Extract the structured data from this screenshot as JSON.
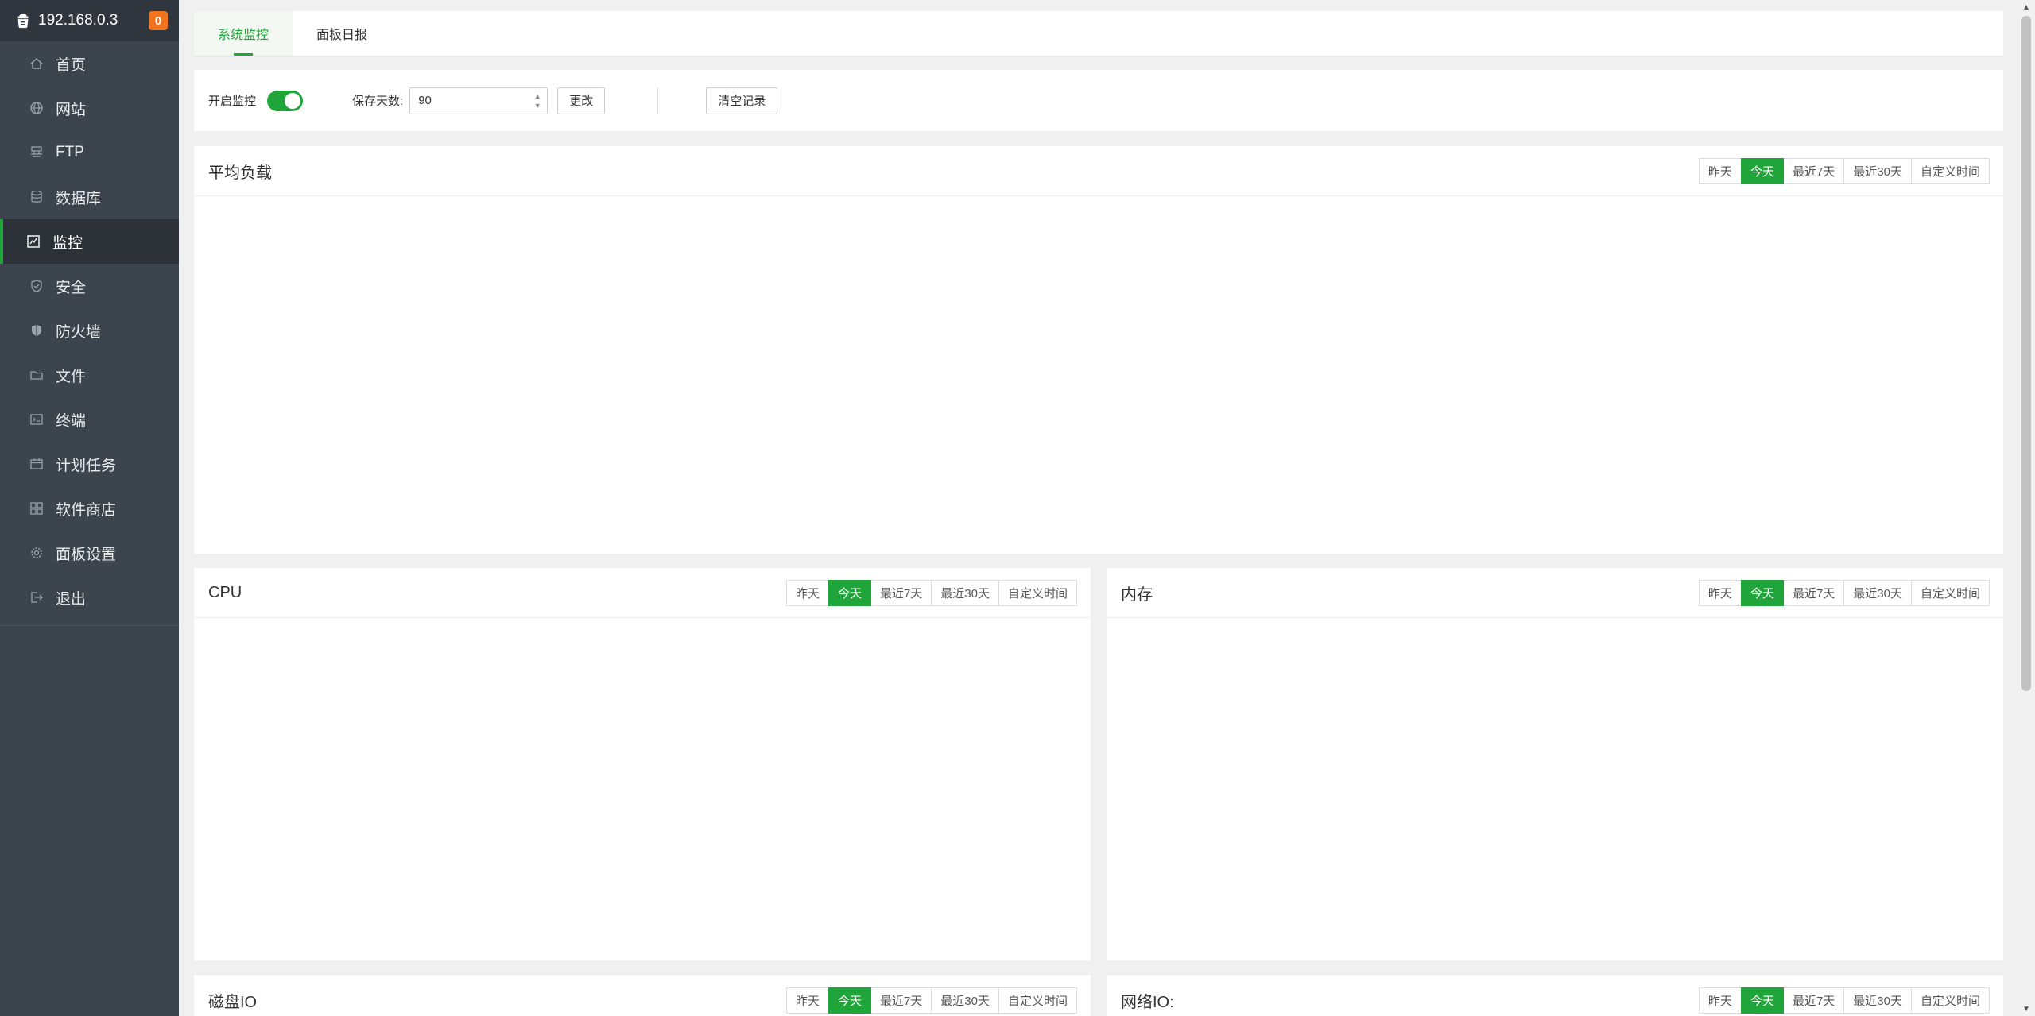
{
  "sidebar": {
    "host": "192.168.0.3",
    "badge": "0",
    "items": [
      {
        "label": "首页",
        "icon": "home-icon"
      },
      {
        "label": "网站",
        "icon": "globe-icon"
      },
      {
        "label": "FTP",
        "icon": "ftp-icon"
      },
      {
        "label": "数据库",
        "icon": "database-icon"
      },
      {
        "label": "监控",
        "icon": "monitor-icon",
        "active": true
      },
      {
        "label": "安全",
        "icon": "shield-check-icon"
      },
      {
        "label": "防火墙",
        "icon": "firewall-icon"
      },
      {
        "label": "文件",
        "icon": "folder-icon"
      },
      {
        "label": "终端",
        "icon": "terminal-icon"
      },
      {
        "label": "计划任务",
        "icon": "calendar-icon"
      },
      {
        "label": "软件商店",
        "icon": "apps-icon"
      },
      {
        "label": "面板设置",
        "icon": "gear-icon"
      },
      {
        "label": "退出",
        "icon": "logout-icon"
      }
    ]
  },
  "tabs": [
    {
      "label": "系统监控",
      "active": true
    },
    {
      "label": "面板日报",
      "active": false
    }
  ],
  "controls": {
    "enable_label": "开启监控",
    "enabled": true,
    "days_label": "保存天数:",
    "days_value": "90",
    "change_button": "更改",
    "clear_button": "清空记录"
  },
  "range_buttons": [
    "昨天",
    "今天",
    "最近7天",
    "最近30天",
    "自定义时间"
  ],
  "active_range": "今天",
  "panels": {
    "load": {
      "title": "平均负载"
    },
    "cpu": {
      "title": "CPU"
    },
    "memory": {
      "title": "内存"
    },
    "disk": {
      "title": "磁盘IO"
    },
    "network": {
      "title": "网络IO:"
    }
  },
  "colors": {
    "accent": "#20a53a",
    "sidebar_bg": "#3c444d",
    "badge": "#f0741e"
  }
}
